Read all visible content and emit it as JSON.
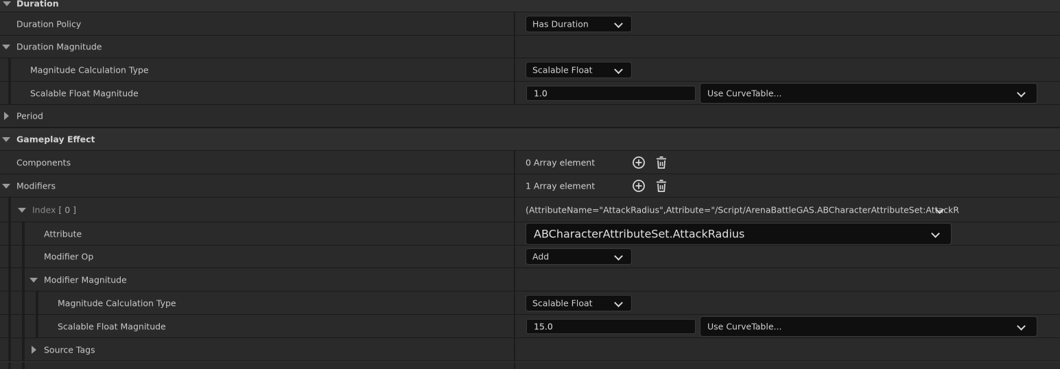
{
  "rows": {
    "duration": {
      "label": "Duration"
    },
    "duration_policy": {
      "label": "Duration Policy",
      "value": "Has Duration"
    },
    "duration_magnitude": {
      "label": "Duration Magnitude"
    },
    "magnitude_calc_type": {
      "label": "Magnitude Calculation Type",
      "value": "Scalable Float"
    },
    "scalable_float": {
      "label": "Scalable Float Magnitude",
      "value": "1.0",
      "curve": "Use CurveTable..."
    },
    "period": {
      "label": "Period"
    },
    "gameplay_effect": {
      "label": "Gameplay Effect"
    },
    "components": {
      "label": "Components",
      "value": "0 Array element"
    },
    "modifiers": {
      "label": "Modifiers",
      "value": "1 Array element"
    },
    "index0": {
      "label": "Index",
      "index_text": "[ 0 ]",
      "value": "(AttributeName=\"AttackRadius\",Attribute=\"/Script/ArenaBattleGAS.ABCharacterAttributeSet:AttackR"
    },
    "attribute": {
      "label": "Attribute",
      "value": "ABCharacterAttributeSet.AttackRadius"
    },
    "modifier_op": {
      "label": "Modifier Op",
      "value": "Add"
    },
    "modifier_magnitude": {
      "label": "Modifier Magnitude"
    },
    "mod_calc_type": {
      "label": "Magnitude Calculation Type",
      "value": "Scalable Float"
    },
    "mod_scalable_float": {
      "label": "Scalable Float Magnitude",
      "value": "15.0",
      "curve": "Use CurveTable..."
    },
    "source_tags": {
      "label": "Source Tags"
    }
  },
  "icons": {
    "add": "add-circle-icon",
    "delete": "trash-icon",
    "expanded": "triangle-down-icon",
    "collapsed": "triangle-right-icon"
  },
  "colors": {
    "panel_bg": "#242424",
    "field_bg": "#0f0f0f",
    "text": "#c8c8c8"
  }
}
